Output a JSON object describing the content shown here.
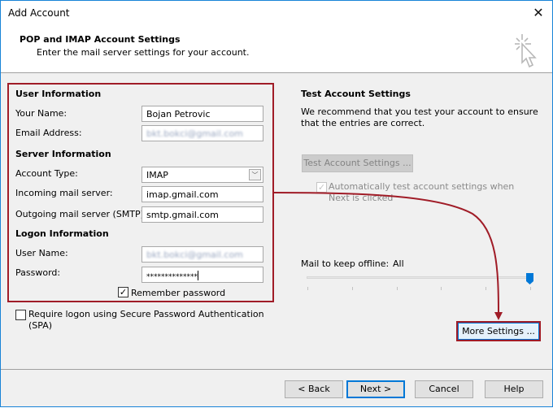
{
  "window": {
    "title": "Add Account",
    "close_icon": "close-icon"
  },
  "header": {
    "title": "POP and IMAP Account Settings",
    "subtitle": "Enter the mail server settings for your account.",
    "icon": "cursor-click-icon"
  },
  "user_information": {
    "heading": "User Information",
    "your_name_label": "Your Name:",
    "your_name_value": "Bojan Petrovic",
    "email_label": "Email Address:",
    "email_value": "bkt.bokci@gmail.com"
  },
  "server_information": {
    "heading": "Server Information",
    "account_type_label": "Account Type:",
    "account_type_value": "IMAP",
    "incoming_label": "Incoming mail server:",
    "incoming_value": "imap.gmail.com",
    "outgoing_label": "Outgoing mail server (SMTP):",
    "outgoing_value": "smtp.gmail.com"
  },
  "logon_information": {
    "heading": "Logon Information",
    "username_label": "User Name:",
    "username_value": "bkt.bokci@gmail.com",
    "password_label": "Password:",
    "password_value": "**************",
    "remember_password_label": "Remember password",
    "remember_password_checked": true
  },
  "spa": {
    "label": "Require logon using Secure Password Authentication (SPA)",
    "checked": false
  },
  "test_settings": {
    "heading": "Test Account Settings",
    "description": "We recommend that you test your account to ensure that the entries are correct.",
    "button_label": "Test Account Settings ...",
    "auto_test_label": "Automatically test account settings when Next is clicked",
    "auto_test_checked": true
  },
  "offline": {
    "label": "Mail to keep offline:",
    "value": "All",
    "slider_position": 1.0,
    "slider_steps": 6
  },
  "more_settings_label": "More Settings ...",
  "footer": {
    "back_label": "< Back",
    "next_label": "Next >",
    "cancel_label": "Cancel",
    "help_label": "Help"
  },
  "colors": {
    "highlight": "#a01c27",
    "accent": "#0078d7"
  }
}
